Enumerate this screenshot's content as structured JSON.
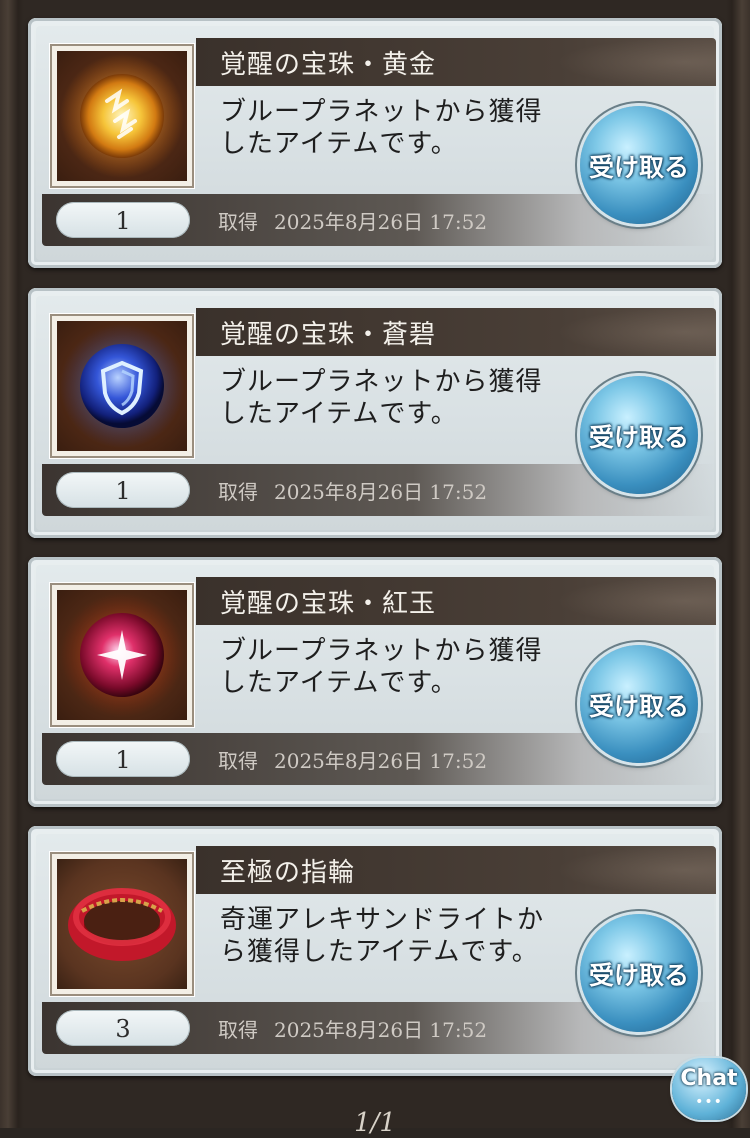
{
  "items": [
    {
      "name": "覚醒の宝珠・黄金",
      "description_line1": "ブループラネットから獲得",
      "description_line2": "したアイテムです。",
      "count": "1",
      "obtained_label": "取得",
      "obtained_time": "2025年8月26日 17:52",
      "button": "受け取る",
      "icon": "gold-orb-icon"
    },
    {
      "name": "覚醒の宝珠・蒼碧",
      "description_line1": "ブループラネットから獲得",
      "description_line2": "したアイテムです。",
      "count": "1",
      "obtained_label": "取得",
      "obtained_time": "2025年8月26日 17:52",
      "button": "受け取る",
      "icon": "blue-orb-icon"
    },
    {
      "name": "覚醒の宝珠・紅玉",
      "description_line1": "ブループラネットから獲得",
      "description_line2": "したアイテムです。",
      "count": "1",
      "obtained_label": "取得",
      "obtained_time": "2025年8月26日 17:52",
      "button": "受け取る",
      "icon": "red-orb-icon"
    },
    {
      "name": "至極の指輪",
      "description_line1": "奇運アレキサンドライトか",
      "description_line2": "ら獲得したアイテムです。",
      "count": "3",
      "obtained_label": "取得",
      "obtained_time": "2025年8月26日 17:52",
      "button": "受け取る",
      "icon": "red-ring-icon"
    }
  ],
  "chat": {
    "label": "Chat",
    "dots": "•••"
  },
  "pager": {
    "text": "1/1"
  },
  "colors": {
    "title_bar": "#3a312b",
    "button_blue": "#3a8fbf",
    "card_bg": "#e3eaec"
  }
}
